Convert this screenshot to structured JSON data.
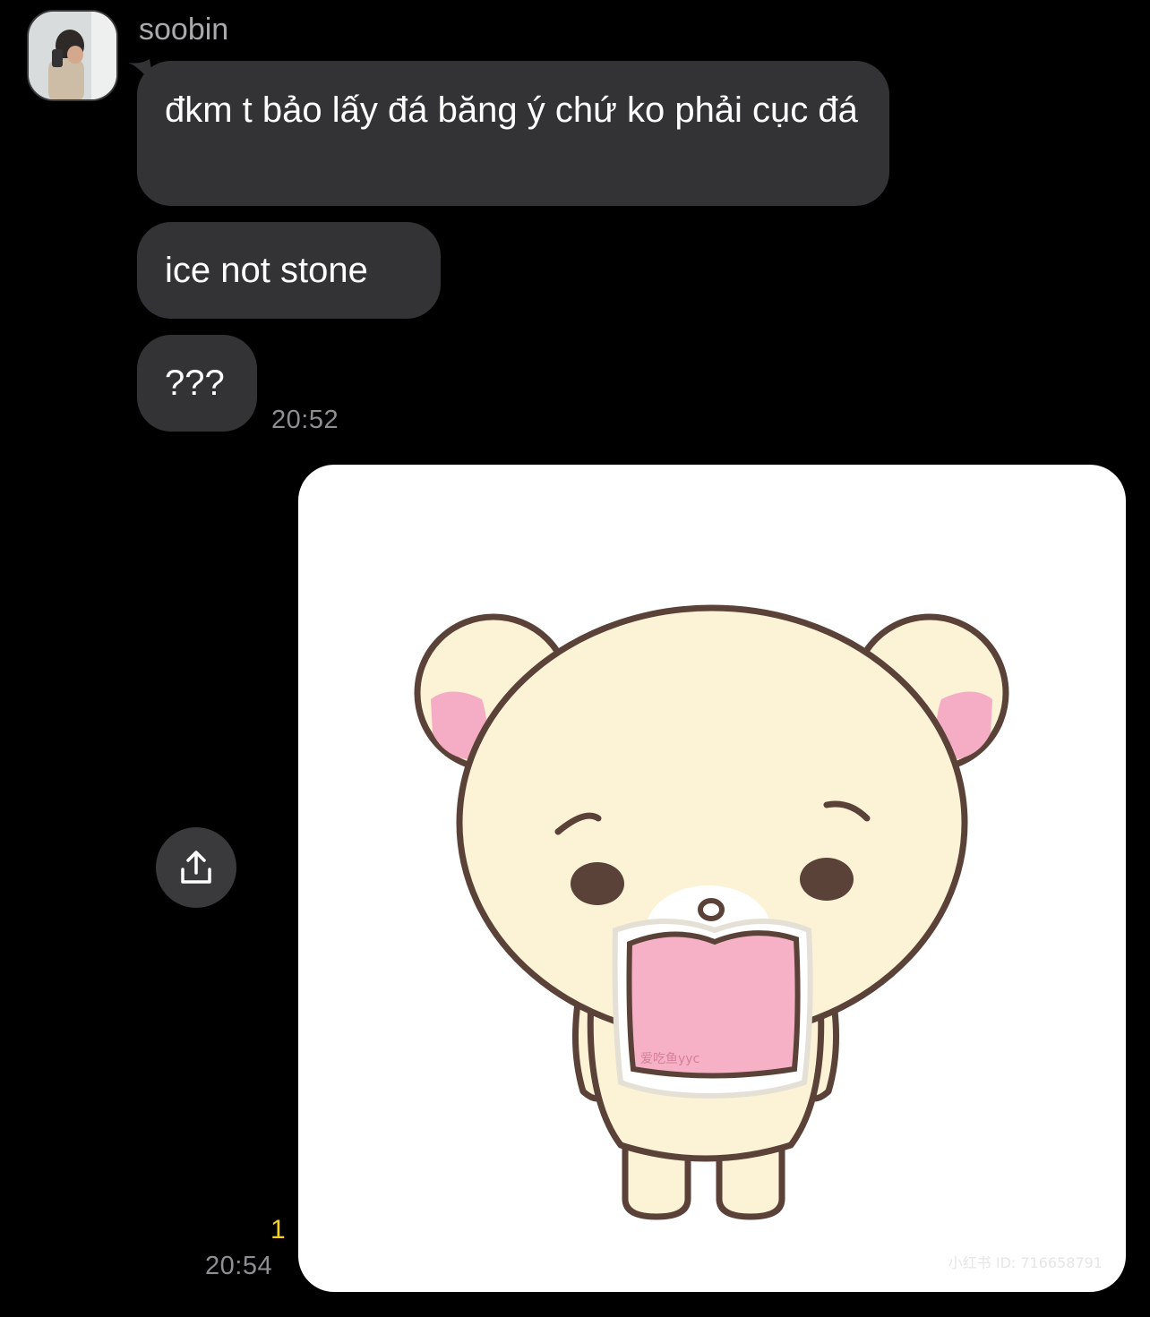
{
  "sender": {
    "name": "soobin"
  },
  "messages": [
    {
      "text": "đkm t bảo lấy đá băng ý chứ ko phải cục đá"
    },
    {
      "text": "ice not stone"
    },
    {
      "text": "???"
    }
  ],
  "timestamps": {
    "incoming": "20:52",
    "outgoing": "20:54"
  },
  "outgoing_image": {
    "read_count": "1",
    "watermark": "小红书 ID: 716658791",
    "mouth_text": "爱吃鱼yyc",
    "description_icon": "share-icon"
  },
  "colors": {
    "bubble": "#333336",
    "timestamp": "#8e8e93",
    "read_count": "#f7d11a",
    "sticker_fill": "#fcf2d5",
    "sticker_pink": "#f7b1c7"
  }
}
